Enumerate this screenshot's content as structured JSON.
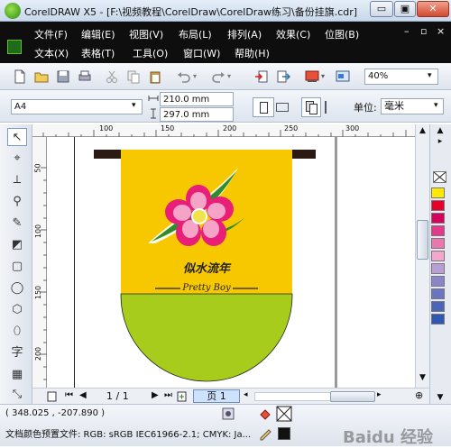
{
  "window": {
    "title": "CorelDRAW X5 - [F:\\视频教程\\CorelDraw\\CorelDraw练习\\备份挂旗.cdr]",
    "minimize": "▭",
    "restore": "▣",
    "close": "✕"
  },
  "menu": {
    "row1": [
      "文件(F)",
      "编辑(E)",
      "视图(V)",
      "布局(L)",
      "排列(A)",
      "效果(C)",
      "位图(B)"
    ],
    "row2": [
      "文本(X)",
      "表格(T)",
      "工具(O)",
      "窗口(W)",
      "帮助(H)"
    ],
    "mdi_controls": [
      "–",
      "▫",
      "×"
    ]
  },
  "toolbar": {
    "zoom": "40%"
  },
  "property_bar": {
    "page_size": "A4",
    "width": "210.0 mm",
    "height": "297.0 mm",
    "units_label": "单位:",
    "units_value": "毫米"
  },
  "rulers": {
    "top_ticks": [
      "100",
      "150",
      "200",
      "250",
      "300"
    ],
    "left_ticks": [
      "50",
      "100",
      "150",
      "200"
    ]
  },
  "artwork": {
    "title_text": "似水流年",
    "subtitle_text": "Pretty  Boy",
    "colors": {
      "top": "#f7c800",
      "bottom": "#a7cc1c",
      "bar": "#2b1a14",
      "petal": "#f06aa8",
      "petal_inner": "#f5a3c7",
      "center": "#f4e24a",
      "leaf": "#2e8b2e"
    }
  },
  "page_nav": {
    "counter": "1 / 1",
    "tab": "页 1"
  },
  "status": {
    "coords": "( 348.025 , -207.890 )",
    "color_profile": "文档颜色预置文件: RGB: sRGB IEC61966-2.1; CMYK: Ja...",
    "watermark": "Baidu 经验"
  },
  "palette_colors": [
    "#ffe800",
    "#e8002a",
    "#d8005c",
    "#e4388a",
    "#ea77b0",
    "#f3a7cd",
    "#b79fd4",
    "#8c86c8",
    "#6b76c2",
    "#4b66b9",
    "#2e58b4"
  ]
}
